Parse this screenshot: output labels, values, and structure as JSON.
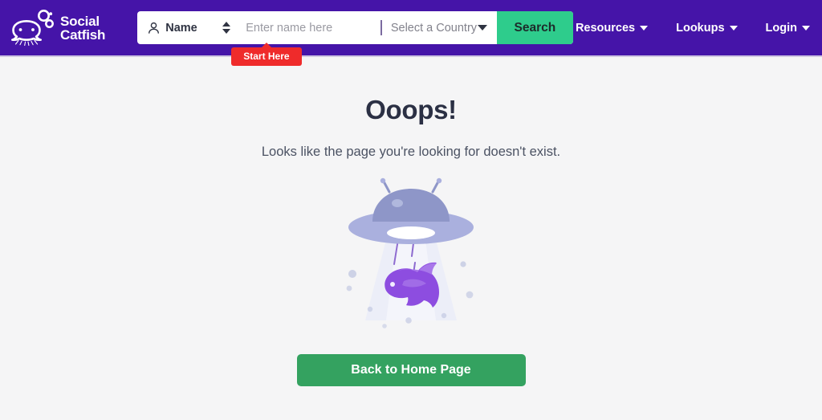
{
  "brand": {
    "name_line1": "Social",
    "name_line2": "Catfish",
    "logo_icon": "catfish-logo-icon",
    "header_bg": "#4514a8"
  },
  "search": {
    "type_label": "Name",
    "type_icon": "person-icon",
    "stepper_icon": "up-down-stepper-icon",
    "name_value": "",
    "name_placeholder": "Enter name here",
    "country_label": "Select a Country",
    "country_caret_icon": "chevron-down-icon",
    "button_label": "Search",
    "button_color": "#2ecc8c",
    "start_here_label": "Start Here",
    "start_here_color": "#ef2b2b"
  },
  "nav": {
    "items": [
      {
        "label": "Resources",
        "caret_icon": "chevron-down-icon"
      },
      {
        "label": "Lookups",
        "caret_icon": "chevron-down-icon"
      },
      {
        "label": "Login",
        "caret_icon": "chevron-down-icon"
      }
    ]
  },
  "main": {
    "title": "Ooops!",
    "subtitle": "Looks like the page you're looking for doesn't exist.",
    "illustration_name": "ufo-abducting-catfish-illustration",
    "cta_label": "Back to Home Page",
    "cta_color": "#34a260",
    "background": "#f5f5f6",
    "title_color": "#2b3044"
  },
  "illustration_colors": {
    "dome": "#8e96c8",
    "saucer": "#aab0de",
    "beam": "#eceef8",
    "fish_body": "#8d4de0",
    "fish_light": "#a877ea",
    "particle": "#c3c9e2"
  }
}
